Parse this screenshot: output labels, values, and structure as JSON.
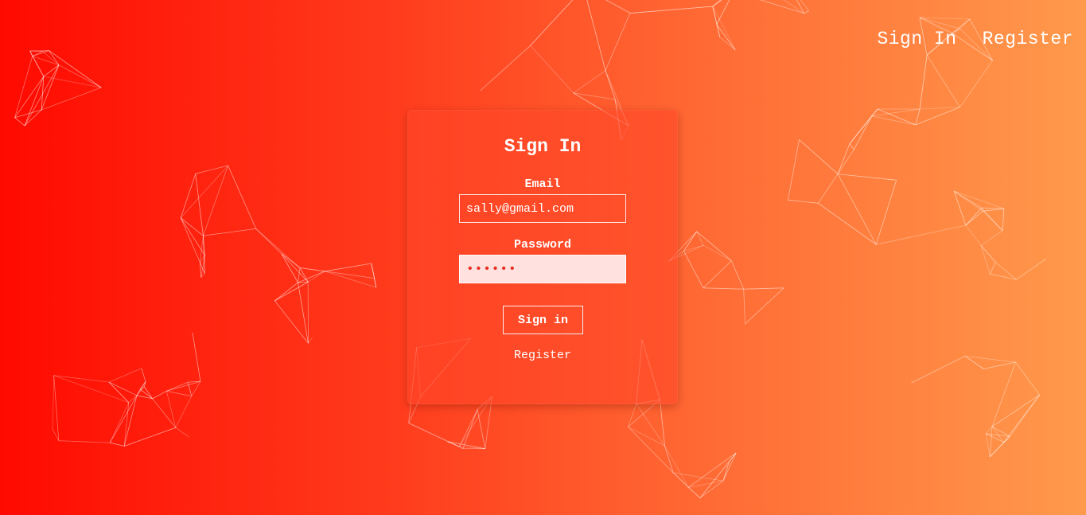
{
  "nav": {
    "signin_label": "Sign In",
    "register_label": "Register"
  },
  "form": {
    "title": "Sign In",
    "email_label": "Email",
    "email_value": "sally@gmail.com",
    "password_label": "Password",
    "password_value": "••••••",
    "submit_label": "Sign in",
    "register_label": "Register"
  },
  "theme": {
    "gradient_start": "#ff0a00",
    "gradient_end": "#ff9a4c",
    "text_color": "#ffffff",
    "password_field_bg": "#ffe1e0"
  }
}
